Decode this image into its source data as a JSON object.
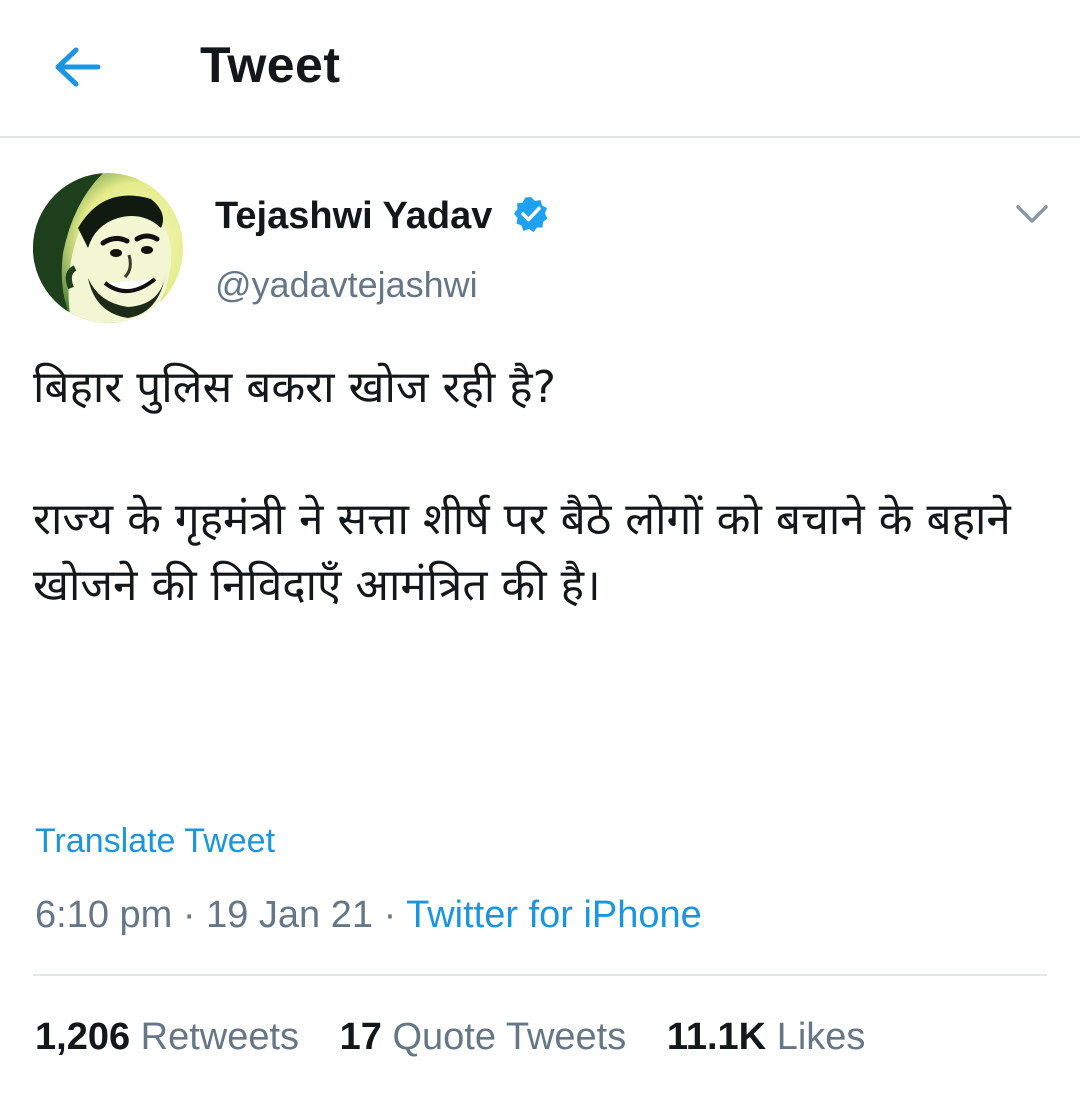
{
  "header": {
    "title": "Tweet",
    "back_icon": "arrow-left-icon"
  },
  "colors": {
    "accent": "#1b95e0",
    "text_primary": "#14171a",
    "text_secondary": "#657786",
    "divider": "#e3e6e9"
  },
  "tweet": {
    "author_name": "Tejashwi Yadav",
    "verified_icon": "verified-badge-icon",
    "handle": "@yadavtejashwi",
    "menu_icon": "chevron-down-icon",
    "text_line_1": "बिहार पुलिस बकरा खोज रही है?",
    "text_line_2": "राज्य के गृहमंत्री ने सत्ता शीर्ष पर बैठे लोगों को बचाने के बहाने खोजने की निविदाएँ आमंत्रित की है।",
    "translate_label": "Translate Tweet",
    "time": "6:10 pm",
    "separator": " · ",
    "date": "19 Jan 21",
    "source": "Twitter for iPhone"
  },
  "stats": {
    "retweets_count": "1,206",
    "retweets_label": "Retweets",
    "quotes_count": "17",
    "quotes_label": "Quote Tweets",
    "likes_count": "11.1K",
    "likes_label": "Likes"
  }
}
